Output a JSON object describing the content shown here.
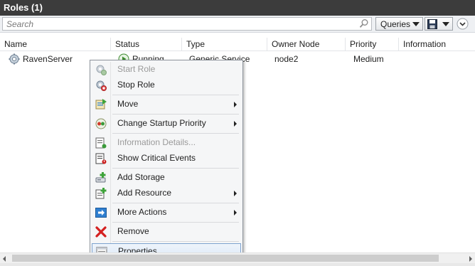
{
  "window": {
    "title": "Roles (1)"
  },
  "toolbar": {
    "search_placeholder": "Search",
    "queries_label": "Queries"
  },
  "columns": [
    "Name",
    "Status",
    "Type",
    "Owner Node",
    "Priority",
    "Information"
  ],
  "rows": [
    {
      "name": "RavenServer",
      "status": "Running",
      "type": "Generic Service",
      "owner": "node2",
      "priority": "Medium",
      "information": ""
    }
  ],
  "context_menu": {
    "items": [
      {
        "label": "Start Role",
        "icon": "start-role-icon",
        "disabled": true
      },
      {
        "label": "Stop Role",
        "icon": "stop-role-icon",
        "disabled": false
      },
      {
        "label": "Move",
        "icon": "move-icon",
        "submenu": true
      },
      {
        "label": "Change Startup Priority",
        "icon": "priority-icon",
        "submenu": true
      },
      {
        "label": "Information Details...",
        "icon": "info-details-icon",
        "disabled": true
      },
      {
        "label": "Show Critical Events",
        "icon": "critical-events-icon"
      },
      {
        "label": "Add Storage",
        "icon": "add-storage-icon"
      },
      {
        "label": "Add Resource",
        "icon": "add-resource-icon",
        "submenu": true
      },
      {
        "label": "More Actions",
        "icon": "more-actions-icon",
        "submenu": true
      },
      {
        "label": "Remove",
        "icon": "remove-icon"
      },
      {
        "label": "Properties",
        "icon": "properties-icon",
        "highlighted": true
      }
    ]
  }
}
